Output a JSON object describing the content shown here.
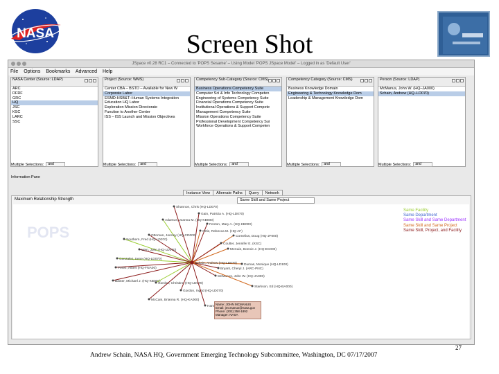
{
  "slide": {
    "title": "Screen Shot",
    "footer": "Andrew Schain, NASA HQ, Government Emerging Technology Subcommittee, Washington, DC 07/17/2007",
    "page_number": "27",
    "logo_text": "NASA"
  },
  "app": {
    "window_title": "JSpace v0.28 RC1 – Connected to 'POPS Sesame' – Using Model 'POPS JSpace Model' – Logged in as 'Default User'",
    "menu": [
      "File",
      "Options",
      "Bookmarks",
      "Advanced",
      "Help"
    ]
  },
  "panels": [
    {
      "title": "NASA Center (Source: LDAP)",
      "items": [
        "ARC",
        "DFRF",
        "GRC",
        "HQ",
        "JSC",
        "KSC",
        "LARC",
        "SSC"
      ],
      "selected": 3
    },
    {
      "title": "Project (Source: WMS)",
      "items": [
        "Center CBA – BSTD – Available for New W",
        "Corporate Labor",
        "ESMD-HSB&T–Human Systems Integration",
        "Education HQ Labor",
        "Exploration Mission Directorate",
        "Function to Another Center",
        "ISS – ISS Launch and Mission Objectives"
      ],
      "selected": 1
    },
    {
      "title": "Competency Sub-Category (Source: CMS)",
      "items": [
        "Business Operations Competency Suite",
        "Computer Sci & Info Technology Competen",
        "Engineering of Systems Competency Suite",
        "Financial Operations Competency Suite",
        "Institutional Operations & Support Compete",
        "Management Competency Suite",
        "Mission Operations Competency Suite",
        "Professional Development Competency Sui",
        "Workforce Operations & Support Competen"
      ],
      "selected": 0
    },
    {
      "title": "Competency Category (Source: CMS)",
      "items": [
        "Business Knowledge Domain",
        "Engineering & Technology Knowledge Dom",
        "Leadership & Management Knowledge Dom"
      ],
      "selected": 1
    },
    {
      "title": "Person (Source: LDAP)",
      "items": [
        "McManus, John W. (HQ–JA000)",
        "Schain, Andrew (HQ–LD070)"
      ],
      "selected": 1
    }
  ],
  "multi_label": "Multiple Selections:",
  "multi_value": "and",
  "info_pane_label": "Information Pane",
  "tabs": [
    "Instance View",
    "Alternate Paths",
    "Query",
    "Network"
  ],
  "graph": {
    "title": "Maximum Relationship Strength",
    "select_value": "Same Skill and Same Project",
    "watermark": "POPS",
    "center_label": "Schain, Andrew (HQ-LD070)",
    "legend": [
      {
        "label": "Same Facility",
        "color": "#9acd32"
      },
      {
        "label": "Same Department",
        "color": "#3a5fcd"
      },
      {
        "label": "Same Skill and Same Department",
        "color": "#9b30ff"
      },
      {
        "label": "Same Skill and Same Project",
        "color": "#d2691e"
      },
      {
        "label": "Same Skill, Project, and Facility",
        "color": "#8b1a1a"
      }
    ],
    "nodes": [
      "Shannon, Chris (HQ-LD070)",
      "Gain, Patricia A. (HQ-LD070)",
      "Adamus, Joanna M. (HQ-KB000)",
      "Fenton, Mary A. (HQ-KB000)",
      "Ortiz, Rebecca M. (HQ-AF)",
      "Ottoman, Jeremy (HQ-CD000)",
      "Southern, Fred (HQ-LD070)",
      "Cornelius, Doug (HQ-JF000)",
      "Coulter, Jennifer E. (KSC)",
      "Wen, John (HQ-LD070)",
      "McCain, Bonnie J. (HQ-EC000)",
      "Gonzalez, Irene (HQ-LD070)",
      "Perez, Albert (HQ-FNA00)",
      "Dumas, Monique (HQ-LD100)",
      "Bryant, Cheryl J. (ARC-PNC)",
      "McManus, John W. (HQ-JA000)",
      "Baxter, Michael J. (HQ-KB000)",
      "Gordon, Christine (HQ-LD070)",
      "Gordon, Ingrid (HQ-LD070)",
      "Starkson, Ed (HQ-BA000)",
      "McCain, Brianna R. (HQ-KA000)",
      "Hamilton, Ivan J. (KSC)"
    ],
    "popup": [
      "Name:  JOHN MCMANUS",
      "Email:  jmcmanus@nasa.gov",
      "Phone:  (202) 358-1892",
      "Manager:  NASA"
    ]
  }
}
